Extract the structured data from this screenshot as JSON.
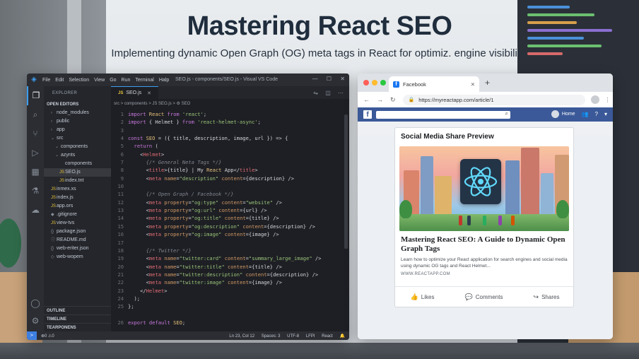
{
  "headline": "Mastering React SEO",
  "subheadline": "Implementing dynamic Open Graph (OG) meta tags in React for optimiz. engine visibility.",
  "vscode": {
    "menu": [
      "File",
      "Edit",
      "Selection",
      "View",
      "Go",
      "Run",
      "Terminal",
      "Halp"
    ],
    "window_title": "SEO.js - components/SEO.js - Visual VS Code",
    "explorer_label": "EXPLORER",
    "open_editors_label": "OPEN EDITORS",
    "tree": [
      {
        "label": "node_modules",
        "icon": "›",
        "indent": 1
      },
      {
        "label": "public",
        "icon": "›",
        "indent": 1
      },
      {
        "label": "app",
        "icon": "›",
        "indent": 1
      },
      {
        "label": "src",
        "icon": "⌄",
        "indent": 1
      },
      {
        "label": "components",
        "icon": "⌄",
        "indent": 2
      },
      {
        "label": "azynts",
        "icon": "⌄",
        "indent": 2
      },
      {
        "label": "components",
        "icon": "",
        "indent": 3
      },
      {
        "label": "SEO.js",
        "icon": "JS",
        "indent": 3,
        "selected": true
      },
      {
        "label": "index.tnt",
        "icon": "JS",
        "indent": 3
      },
      {
        "label": "inmex.xs",
        "icon": "JS",
        "indent": 1
      },
      {
        "label": "index.js",
        "icon": "JS",
        "indent": 1
      },
      {
        "label": "app.ors",
        "icon": "JS",
        "indent": 1
      },
      {
        "label": ".gitignore",
        "icon": "◆",
        "indent": 1
      },
      {
        "label": "view-tvs",
        "icon": "JS",
        "indent": 1
      },
      {
        "label": "package.json",
        "icon": "{}",
        "indent": 1
      },
      {
        "label": "README.md",
        "icon": "ⓘ",
        "indent": 1
      },
      {
        "label": "web-eriter.json",
        "icon": "{}",
        "indent": 1
      },
      {
        "label": "web-wopem",
        "icon": "◇",
        "indent": 1
      }
    ],
    "bottom_sections": [
      "OUTLINE",
      "TIMELINE",
      "TEARPONENS"
    ],
    "tab_label": "SEO.js",
    "breadcrumb": "src > components > JS SEO.js > ⚙ SEO",
    "code_lines": [
      {
        "n": "1",
        "t": "import React from 'react';"
      },
      {
        "n": "2",
        "t": "import { Helmet } from 'react-helmet-async';"
      },
      {
        "n": "3",
        "t": ""
      },
      {
        "n": "4",
        "t": "const SEO = ({ title, description, image, url }) => {"
      },
      {
        "n": "5",
        "t": "  return ("
      },
      {
        "n": "6",
        "t": "    <Helmet>"
      },
      {
        "n": "7",
        "t": "      {/* General Neta Tags */}"
      },
      {
        "n": "8",
        "t": "      <title>{title} | My React App</title>"
      },
      {
        "n": "9",
        "t": "      <meta name=\"description\" content={description} />"
      },
      {
        "n": "10",
        "t": ""
      },
      {
        "n": "11",
        "t": "      {/* Open Graph / Facebook */}"
      },
      {
        "n": "12",
        "t": "      <meta property=\"og:type\" content=\"website\" />"
      },
      {
        "n": "13",
        "t": "      <meta property=\"og:url\" content={url} />"
      },
      {
        "n": "14",
        "t": "      <meta property=\"og:title\" content={title} />"
      },
      {
        "n": "15",
        "t": "      <meta property=\"og:description\" content={description} />"
      },
      {
        "n": "16",
        "t": "      <meta property=\"og:image\" content={image} />"
      },
      {
        "n": "17",
        "t": ""
      },
      {
        "n": "18",
        "t": "      {/* Twitter */}"
      },
      {
        "n": "19",
        "t": "      <meta name=\"twitter:card\" content=\"summary_large_image\" />"
      },
      {
        "n": "20",
        "t": "      <meta name=\"twitter:title\" content={title} />"
      },
      {
        "n": "21",
        "t": "      <meta name=\"twitter:description\" content={description} />"
      },
      {
        "n": "22",
        "t": "      <meta name=\"twitter:image\" content={image} />"
      },
      {
        "n": "23",
        "t": "    </Helmet>"
      },
      {
        "n": "24",
        "t": "  );"
      },
      {
        "n": "25",
        "t": "};"
      },
      {
        "n": "",
        "t": ""
      },
      {
        "n": "26",
        "t": "export default SEO;"
      }
    ],
    "status": {
      "left": "⊗0 ⚠0",
      "cursor": "Ln 23, Col 12",
      "spaces": "Spaces: 3",
      "encoding": "UTF-8",
      "eol": "LFPI",
      "language": "React"
    }
  },
  "browser": {
    "tab_title": "Facebook",
    "url": "https://myreactapp.com/article/1",
    "fb_home": "Home",
    "card": {
      "title": "Social Media Share Preview",
      "heading": "Mastering React SEO: A Guide to Dynamic Open Graph Tags",
      "description": "Learn how to optimize your React application for search engines and social media using dynamic OG tags and React Helmet...",
      "domain": "WWW.REACTAPP.COM",
      "actions": [
        "Likes",
        "Comments",
        "Shares"
      ]
    }
  },
  "colors": {
    "vscode_bg": "#1e1f24",
    "accent_blue": "#3d9ef0",
    "facebook_blue": "#3b5998",
    "headline": "#1f2d3d"
  }
}
